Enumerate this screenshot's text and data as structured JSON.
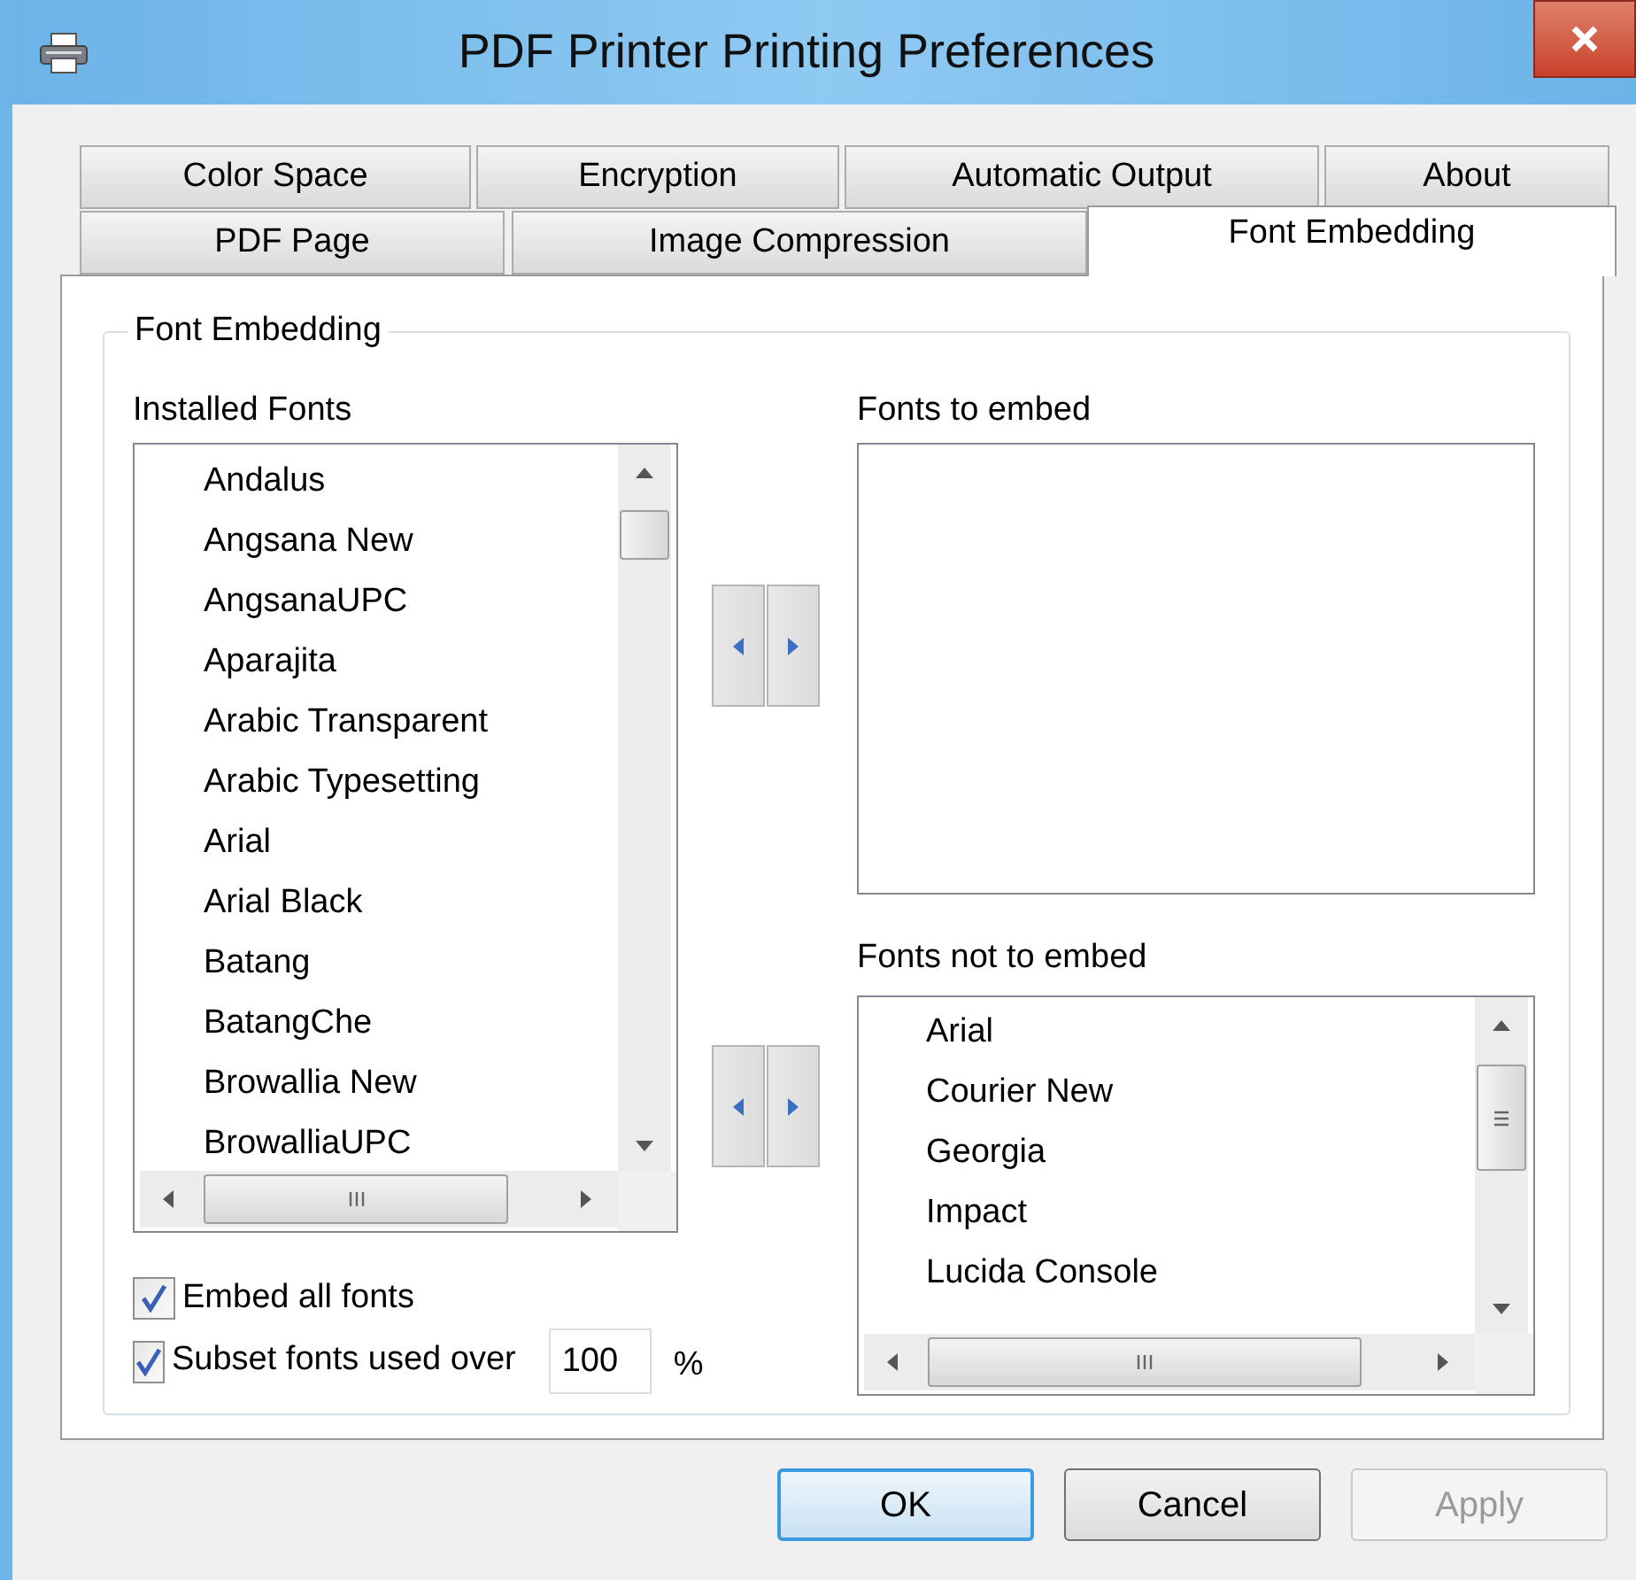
{
  "window": {
    "title": "PDF Printer Printing Preferences"
  },
  "tab_rows": [
    {
      "tabs": [
        {
          "label": "Color Space",
          "selected": false
        },
        {
          "label": "Encryption",
          "selected": false
        },
        {
          "label": "Automatic Output",
          "selected": false
        },
        {
          "label": "About",
          "selected": false
        }
      ]
    },
    {
      "tabs": [
        {
          "label": "PDF Page",
          "selected": false
        },
        {
          "label": "Image Compression",
          "selected": false
        },
        {
          "label": "Font Embedding",
          "selected": true
        }
      ]
    }
  ],
  "group": {
    "title": "Font Embedding"
  },
  "installed_fonts": {
    "label": "Installed Fonts",
    "items": [
      "Andalus",
      "Angsana New",
      "AngsanaUPC",
      "Aparajita",
      "Arabic Transparent",
      "Arabic Typesetting",
      "Arial",
      "Arial Black",
      "Batang",
      "BatangChe",
      "Browallia New",
      "BrowalliaUPC"
    ]
  },
  "fonts_to_embed": {
    "label": "Fonts to embed"
  },
  "fonts_not_to_embed": {
    "label": "Fonts not to embed",
    "items": [
      "Arial",
      "Courier New",
      "Georgia",
      "Impact",
      "Lucida Console"
    ]
  },
  "options": [
    {
      "label": "Embed all fonts",
      "checked": true
    },
    {
      "label": "Subset fonts used over",
      "checked": true,
      "value": "100",
      "unit": "%"
    }
  ],
  "buttons": [
    {
      "label": "OK",
      "default": true,
      "disabled": false
    },
    {
      "label": "Cancel",
      "default": false,
      "disabled": false
    },
    {
      "label": "Apply",
      "default": false,
      "disabled": true
    }
  ]
}
